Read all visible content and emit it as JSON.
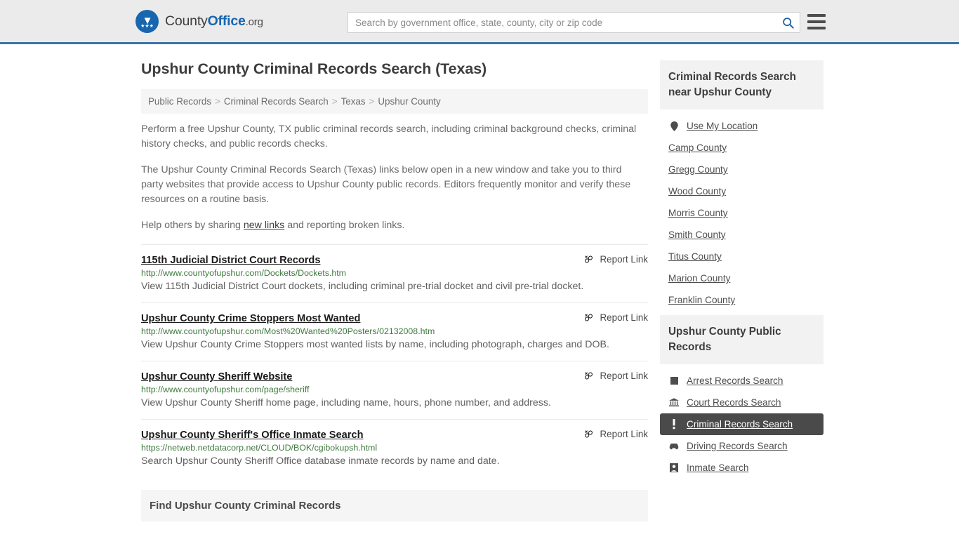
{
  "header": {
    "logo": {
      "part1": "County",
      "part2": "Office",
      "part3": ".org",
      "icon": "eagle-stars-emblem"
    },
    "search": {
      "placeholder": "Search by government office, state, county, city or zip code",
      "value": "",
      "icon": "search-icon"
    },
    "menu_icon": "hamburger-menu-icon",
    "accent_color": "#3b72a8",
    "background_color": "#ebebeb"
  },
  "page": {
    "title": "Upshur County Criminal Records Search (Texas)"
  },
  "breadcrumb": {
    "separator": ">",
    "items": [
      {
        "label": "Public Records"
      },
      {
        "label": "Criminal Records Search"
      },
      {
        "label": "Texas"
      },
      {
        "label": "Upshur County"
      }
    ]
  },
  "intro": {
    "p1": "Perform a free Upshur County, TX public criminal records search, including criminal background checks, criminal history checks, and public records checks.",
    "p2": "The Upshur County Criminal Records Search (Texas) links below open in a new window and take you to third party websites that provide access to Upshur County public records. Editors frequently monitor and verify these resources on a routine basis.",
    "p3_before": "Help others by sharing ",
    "p3_link": "new links",
    "p3_after": " and reporting broken links."
  },
  "results": {
    "report_label": "Report Link",
    "report_icon": "broken-link-icon",
    "items": [
      {
        "title": "115th Judicial District Court Records",
        "url": "http://www.countyofupshur.com/Dockets/Dockets.htm",
        "description": "View 115th Judicial District Court dockets, including criminal pre-trial docket and civil pre-trial docket."
      },
      {
        "title": "Upshur County Crime Stoppers Most Wanted",
        "url": "http://www.countyofupshur.com/Most%20Wanted%20Posters/02132008.htm",
        "description": "View Upshur County Crime Stoppers most wanted lists by name, including photograph, charges and DOB."
      },
      {
        "title": "Upshur County Sheriff Website",
        "url": "http://www.countyofupshur.com/page/sheriff",
        "description": "View Upshur County Sheriff home page, including name, hours, phone number, and address."
      },
      {
        "title": "Upshur County Sheriff's Office Inmate Search",
        "url": "https://netweb.netdatacorp.net/CLOUD/BOK/cgibokupsh.html",
        "description": "Search Upshur County Sheriff Office database inmate records by name and date."
      }
    ]
  },
  "find_section": {
    "heading": "Find Upshur County Criminal Records"
  },
  "sidebar": {
    "nearby": {
      "heading": "Criminal Records Search near Upshur County",
      "items": [
        {
          "label": "Use My Location",
          "icon": "map-pin-icon"
        },
        {
          "label": "Camp County",
          "icon": ""
        },
        {
          "label": "Gregg County",
          "icon": ""
        },
        {
          "label": "Wood County",
          "icon": ""
        },
        {
          "label": "Morris County",
          "icon": ""
        },
        {
          "label": "Smith County",
          "icon": ""
        },
        {
          "label": "Titus County",
          "icon": ""
        },
        {
          "label": "Marion County",
          "icon": ""
        },
        {
          "label": "Franklin County",
          "icon": ""
        }
      ]
    },
    "public_records": {
      "heading": "Upshur County Public Records",
      "active_item": "Criminal Records Search",
      "active_background": "#4a4a4a",
      "items": [
        {
          "label": "Arrest Records Search",
          "icon": "square-icon",
          "active": false
        },
        {
          "label": "Court Records Search",
          "icon": "courthouse-icon",
          "active": false
        },
        {
          "label": "Criminal Records Search",
          "icon": "exclamation-icon",
          "active": true
        },
        {
          "label": "Driving Records Search",
          "icon": "car-icon",
          "active": false
        },
        {
          "label": "Inmate Search",
          "icon": "inmate-icon",
          "active": false
        }
      ]
    }
  }
}
